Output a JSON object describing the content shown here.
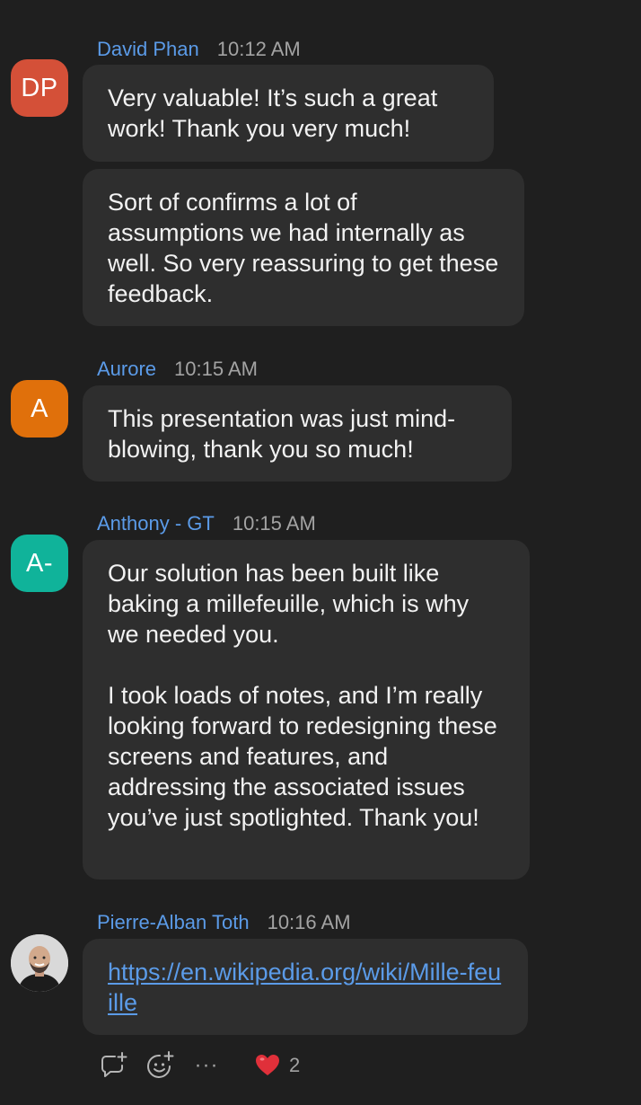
{
  "colors": {
    "background": "#1f1f1f",
    "bubble": "#2e2e2e",
    "name": "#5b9be8",
    "timestamp": "#a3a3a3",
    "avatar_dp": "#d45038",
    "avatar_a": "#e0700b",
    "avatar_a_dash": "#10b39a"
  },
  "messages": [
    {
      "sender": "David Phan",
      "time": "10:12 AM",
      "initials": "DP",
      "bubbles": [
        "Very valuable! It’s such a great work! Thank you very much!",
        "Sort of confirms a lot of assumptions we had internally as well. So very reassuring to get these feedback."
      ]
    },
    {
      "sender": "Aurore",
      "time": "10:15 AM",
      "initials": "A",
      "bubbles": [
        "This presentation was just mind-blowing, thank you so much!"
      ]
    },
    {
      "sender": "Anthony - GT",
      "time": "10:15 AM",
      "initials": "A-",
      "paragraphs": [
        "Our solution has been built like baking a millefeuille, which is why we needed you.",
        "I took loads of notes, and I’m really looking forward to redesigning these screens and features, and addressing the associated issues you’ve just spotlighted. Thank you!"
      ]
    },
    {
      "sender": "Pierre-Alban Toth",
      "time": "10:16 AM",
      "avatar_icon": "profile-photo",
      "link": "https://en.wikipedia.org/wiki/Mille-feuille"
    }
  ],
  "actions": {
    "reply_icon": "reply-plus-icon",
    "react_icon": "emoji-plus-icon",
    "more_label": "···",
    "reaction_emoji": "❤️",
    "reaction_count": "2"
  }
}
